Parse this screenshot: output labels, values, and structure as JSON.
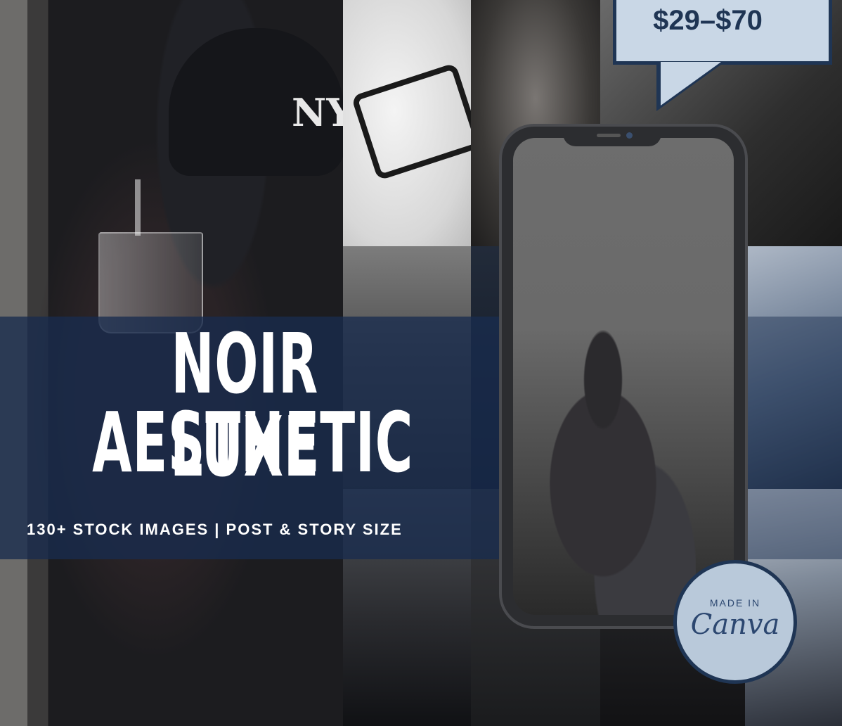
{
  "title": {
    "line1": "NOIR LUXE",
    "line2": "AESTHETIC"
  },
  "subtitle": "130+ STOCK IMAGES | POST & STORY SIZE",
  "price": "$29–$70",
  "badge": {
    "top": "MADE IN",
    "main": "Canva"
  },
  "cap_logo": "NY",
  "colors": {
    "band": "#182c4e",
    "price_border": "#1f3554",
    "price_fill": "#c9d7e6",
    "badge_fill": "#b9c9da"
  }
}
